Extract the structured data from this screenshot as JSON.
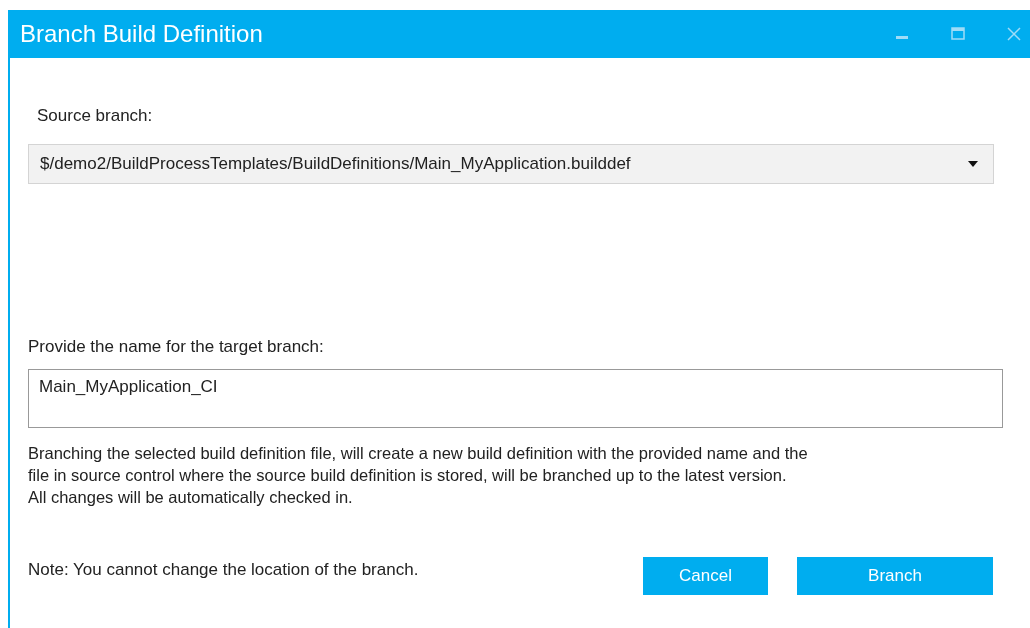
{
  "window": {
    "title": "Branch Build Definition"
  },
  "source_branch": {
    "label": "Source branch:",
    "value": "$/demo2/BuildProcessTemplates/BuildDefinitions/Main_MyApplication.builddef"
  },
  "target_name": {
    "label": "Provide the name for the target branch:",
    "value": "Main_MyApplication_CI"
  },
  "description": "Branching the selected build definition file, will create a new build definition with the provided name and the\nfile in source control where the source build definition is stored, will be branched up to the latest version.\nAll changes will be automatically checked in.",
  "note": "Note: You cannot change the location of the branch.",
  "buttons": [
    "Cancel",
    "Branch"
  ]
}
